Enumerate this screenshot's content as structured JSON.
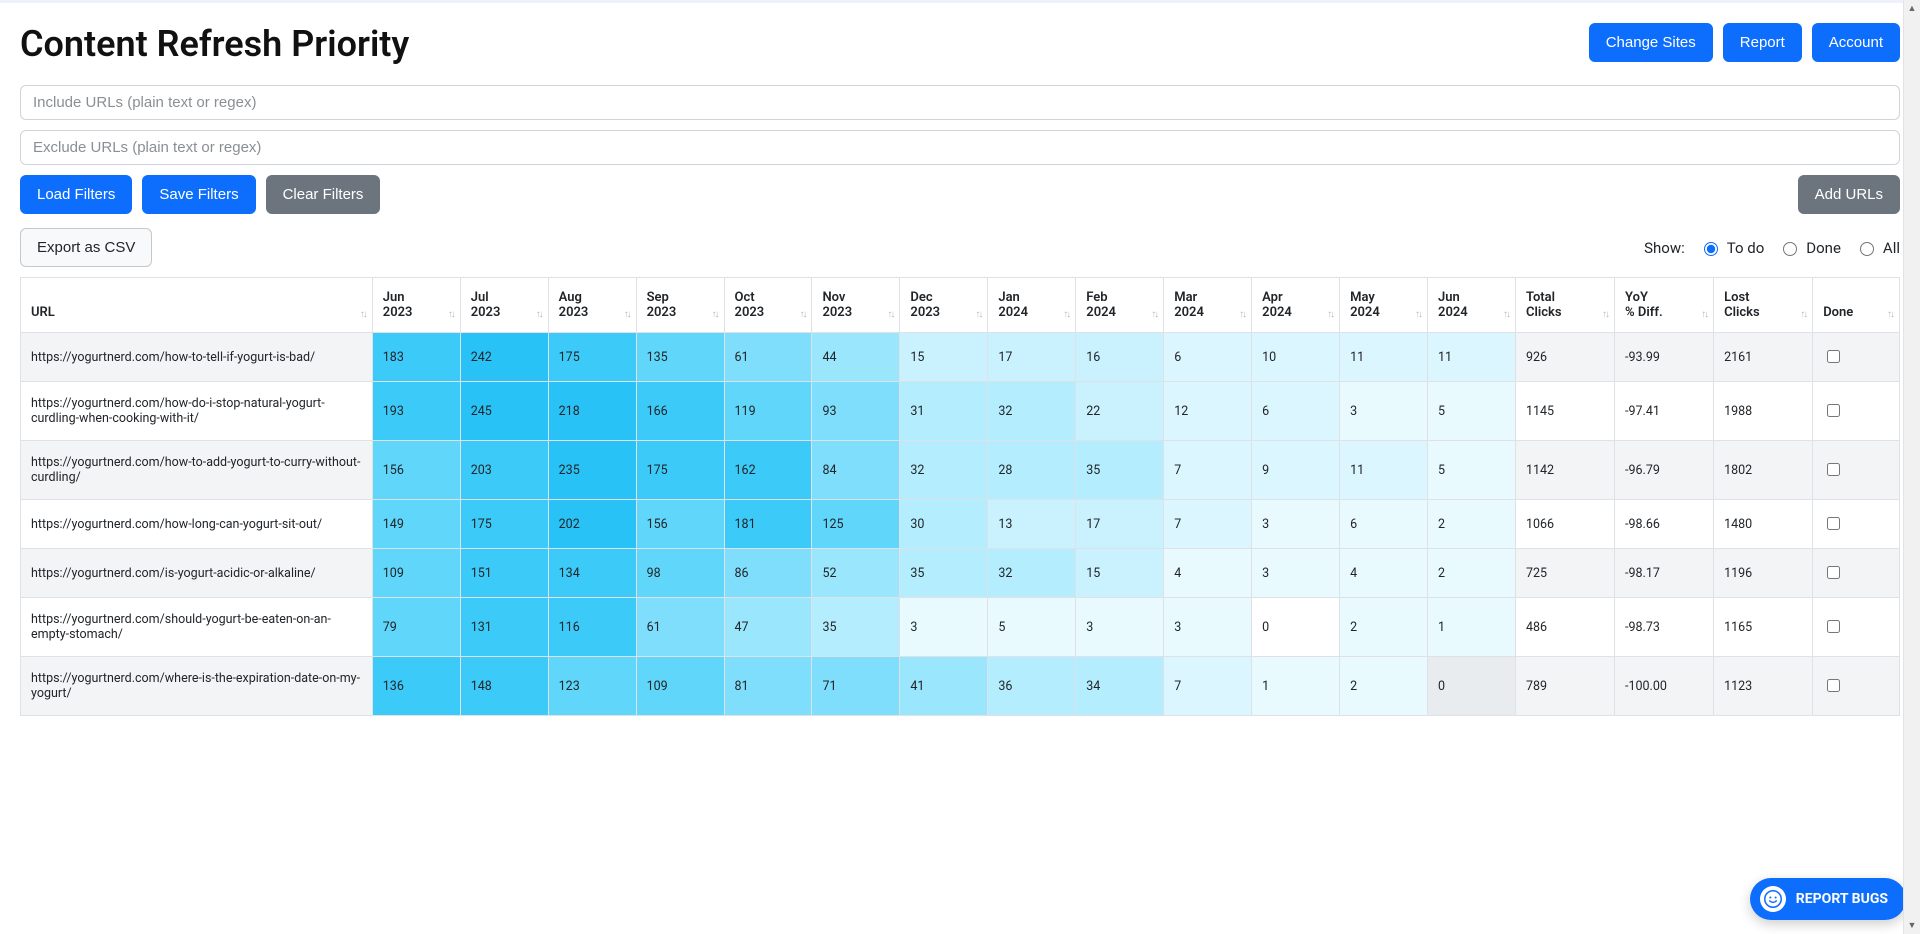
{
  "header": {
    "title": "Content Refresh Priority",
    "buttons": {
      "change_sites": "Change Sites",
      "report": "Report",
      "account": "Account"
    }
  },
  "filters": {
    "include_placeholder": "Include URLs (plain text or regex)",
    "exclude_placeholder": "Exclude URLs (plain text or regex)",
    "load": "Load Filters",
    "save": "Save Filters",
    "clear": "Clear Filters",
    "add_urls": "Add URLs"
  },
  "toolbar": {
    "export": "Export as CSV",
    "show_label": "Show:",
    "show_options": {
      "todo": "To do",
      "done": "Done",
      "all": "All"
    },
    "show_selected": "todo"
  },
  "table": {
    "columns": {
      "url": "URL",
      "months": [
        "Jun 2023",
        "Jul 2023",
        "Aug 2023",
        "Sep 2023",
        "Oct 2023",
        "Nov 2023",
        "Dec 2023",
        "Jan 2024",
        "Feb 2024",
        "Mar 2024",
        "Apr 2024",
        "May 2024",
        "Jun 2024"
      ],
      "total": "Total Clicks",
      "yoy": "YoY % Diff.",
      "lost": "Lost Clicks",
      "done": "Done"
    },
    "rows": [
      {
        "url": "https://yogurtnerd.com/how-to-tell-if-yogurt-is-bad/",
        "m": [
          183,
          242,
          175,
          135,
          61,
          44,
          15,
          17,
          16,
          6,
          10,
          11,
          11
        ],
        "h": [
          "h1",
          "h0",
          "h1",
          "h2",
          "h3",
          "h4",
          "h6",
          "h6",
          "h6",
          "h7",
          "h7",
          "h7",
          "h7"
        ],
        "total": 926,
        "yoy": "-93.99",
        "lost": 2161,
        "done": false
      },
      {
        "url": "https://yogurtnerd.com/how-do-i-stop-natural-yogurt-curdling-when-cooking-with-it/",
        "m": [
          193,
          245,
          218,
          166,
          119,
          93,
          31,
          32,
          22,
          12,
          6,
          3,
          5
        ],
        "h": [
          "h1",
          "h0",
          "h0",
          "h1",
          "h2",
          "h3",
          "h5",
          "h5",
          "h6",
          "h7",
          "h7",
          "h8",
          "h8"
        ],
        "total": 1145,
        "yoy": "-97.41",
        "lost": 1988,
        "done": false
      },
      {
        "url": "https://yogurtnerd.com/how-to-add-yogurt-to-curry-without-curdling/",
        "m": [
          156,
          203,
          235,
          175,
          162,
          84,
          32,
          28,
          35,
          7,
          9,
          11,
          5
        ],
        "h": [
          "h2",
          "h1",
          "h0",
          "h1",
          "h1",
          "h3",
          "h5",
          "h5",
          "h5",
          "h7",
          "h7",
          "h7",
          "h8"
        ],
        "total": 1142,
        "yoy": "-96.79",
        "lost": 1802,
        "done": false
      },
      {
        "url": "https://yogurtnerd.com/how-long-can-yogurt-sit-out/",
        "m": [
          149,
          175,
          202,
          156,
          181,
          125,
          30,
          13,
          17,
          7,
          3,
          6,
          2
        ],
        "h": [
          "h2",
          "h1",
          "h0",
          "h2",
          "h1",
          "h2",
          "h5",
          "h6",
          "h6",
          "h7",
          "h8",
          "h8",
          "h8"
        ],
        "total": 1066,
        "yoy": "-98.66",
        "lost": 1480,
        "done": false
      },
      {
        "url": "https://yogurtnerd.com/is-yogurt-acidic-or-alkaline/",
        "m": [
          109,
          151,
          134,
          98,
          86,
          52,
          35,
          32,
          15,
          4,
          3,
          4,
          2
        ],
        "h": [
          "h2",
          "h1",
          "h1",
          "h2",
          "h3",
          "h4",
          "h5",
          "h5",
          "h6",
          "h8",
          "h8",
          "h8",
          "h8"
        ],
        "total": 725,
        "yoy": "-98.17",
        "lost": 1196,
        "done": false
      },
      {
        "url": "https://yogurtnerd.com/should-yogurt-be-eaten-on-an-empty-stomach/",
        "m": [
          79,
          131,
          116,
          61,
          47,
          35,
          3,
          5,
          3,
          3,
          0,
          2,
          1
        ],
        "h": [
          "h2",
          "h1",
          "h1",
          "h3",
          "h4",
          "h5",
          "h8",
          "h8",
          "h8",
          "h8",
          "h9",
          "h8",
          "h8"
        ],
        "total": 486,
        "yoy": "-98.73",
        "lost": 1165,
        "done": false
      },
      {
        "url": "https://yogurtnerd.com/where-is-the-expiration-date-on-my-yogurt/",
        "m": [
          136,
          148,
          123,
          109,
          81,
          71,
          41,
          36,
          34,
          7,
          1,
          2,
          0
        ],
        "h": [
          "h1",
          "h1",
          "h2",
          "h2",
          "h3",
          "h3",
          "h4",
          "h5",
          "h5",
          "h7",
          "h8",
          "h8",
          "hg"
        ],
        "total": 789,
        "yoy": "-100.00",
        "lost": 1123,
        "done": false
      }
    ]
  },
  "bug_widget": {
    "label": "REPORT BUGS"
  }
}
